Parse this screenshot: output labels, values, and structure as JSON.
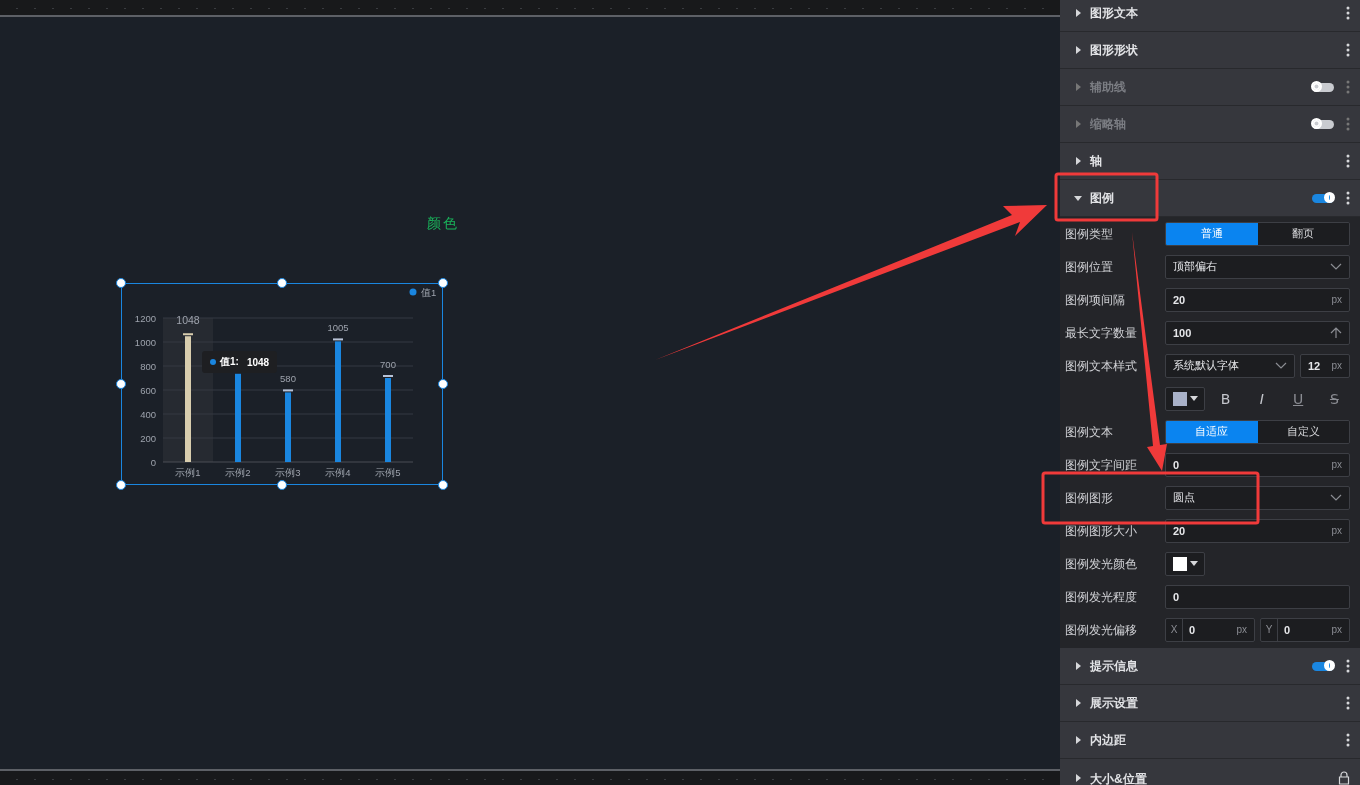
{
  "canvas": {
    "caption": "颜色"
  },
  "chart": {
    "tooltip": {
      "label": "值1:",
      "value": "1048"
    },
    "chart_data": {
      "type": "bar",
      "categories": [
        "示例1",
        "示例2",
        "示例3",
        "示例4",
        "示例5"
      ],
      "series": [
        {
          "name": "值1",
          "color": "#1a86e0",
          "values": [
            1048,
            735,
            580,
            1005,
            700
          ],
          "colors": [
            "#d8cdae",
            null,
            null,
            null,
            null
          ]
        }
      ],
      "ylim": [
        0,
        1200
      ],
      "yticks": [
        0,
        200,
        400,
        600,
        800,
        1000,
        1200
      ],
      "grid": true,
      "value_labels": [
        "1048",
        null,
        "580",
        "1005",
        "700"
      ]
    }
  },
  "sections_top": [
    {
      "label": "图形文本",
      "expanded": false,
      "disabled": false,
      "kind": "more"
    },
    {
      "label": "图形形状",
      "expanded": false,
      "disabled": false,
      "kind": "more"
    },
    {
      "label": "辅助线",
      "expanded": false,
      "disabled": true,
      "toggle": false,
      "kind": "more"
    },
    {
      "label": "缩略轴",
      "expanded": false,
      "disabled": true,
      "toggle": false,
      "kind": "more"
    },
    {
      "label": "轴",
      "expanded": false,
      "disabled": false,
      "kind": "more"
    },
    {
      "label": "图例",
      "expanded": true,
      "disabled": false,
      "toggle": true,
      "kind": "more"
    }
  ],
  "legend_form": [
    {
      "kind": "segmented",
      "label": "图例类型",
      "options": [
        {
          "label": "普通",
          "selected": true
        },
        {
          "label": "翻页",
          "selected": false
        }
      ]
    },
    {
      "kind": "select",
      "label": "图例位置",
      "value": "顶部偏右"
    },
    {
      "kind": "number",
      "label": "图例项间隔",
      "value": "20",
      "unit": "px"
    },
    {
      "kind": "stepper",
      "label": "最长文字数量",
      "value": "100"
    },
    {
      "kind": "font",
      "label": "图例文本样式",
      "value": "系统默认字体",
      "size": "12",
      "unit": "px"
    },
    {
      "kind": "text_style",
      "color": "#a9b1c8",
      "buttons": [
        {
          "text": "B",
          "kind": "bold"
        },
        {
          "text": "I",
          "kind": "italic"
        },
        {
          "text": "U",
          "kind": "underline"
        },
        {
          "text": "S",
          "kind": "strike"
        }
      ]
    },
    {
      "kind": "segmented",
      "label": "图例文本",
      "options": [
        {
          "label": "自适应",
          "selected": true
        },
        {
          "label": "自定义",
          "selected": false
        }
      ]
    },
    {
      "kind": "number",
      "label": "图例文字间距",
      "value": "0",
      "unit": "px"
    },
    {
      "kind": "select",
      "label": "图例图形",
      "value": "圆点"
    },
    {
      "kind": "number",
      "label": "图例图形大小",
      "value": "20",
      "unit": "px"
    },
    {
      "kind": "color",
      "label": "图例发光颜色",
      "color": "#ffffff"
    },
    {
      "kind": "number",
      "label": "图例发光程度",
      "value": "0"
    },
    {
      "kind": "xy",
      "label": "图例发光偏移",
      "fields": [
        {
          "axis": "X",
          "value": "0",
          "unit": "px"
        },
        {
          "axis": "Y",
          "value": "0",
          "unit": "px"
        }
      ]
    }
  ],
  "sections_bottom": [
    {
      "label": "提示信息",
      "expanded": false,
      "disabled": false,
      "toggle": true,
      "kind": "more"
    },
    {
      "label": "展示设置",
      "expanded": false,
      "disabled": false,
      "kind": "more"
    },
    {
      "label": "内边距",
      "expanded": false,
      "disabled": false,
      "kind": "more"
    },
    {
      "label": "大小&位置",
      "disabled": false,
      "kind": "lock"
    }
  ]
}
